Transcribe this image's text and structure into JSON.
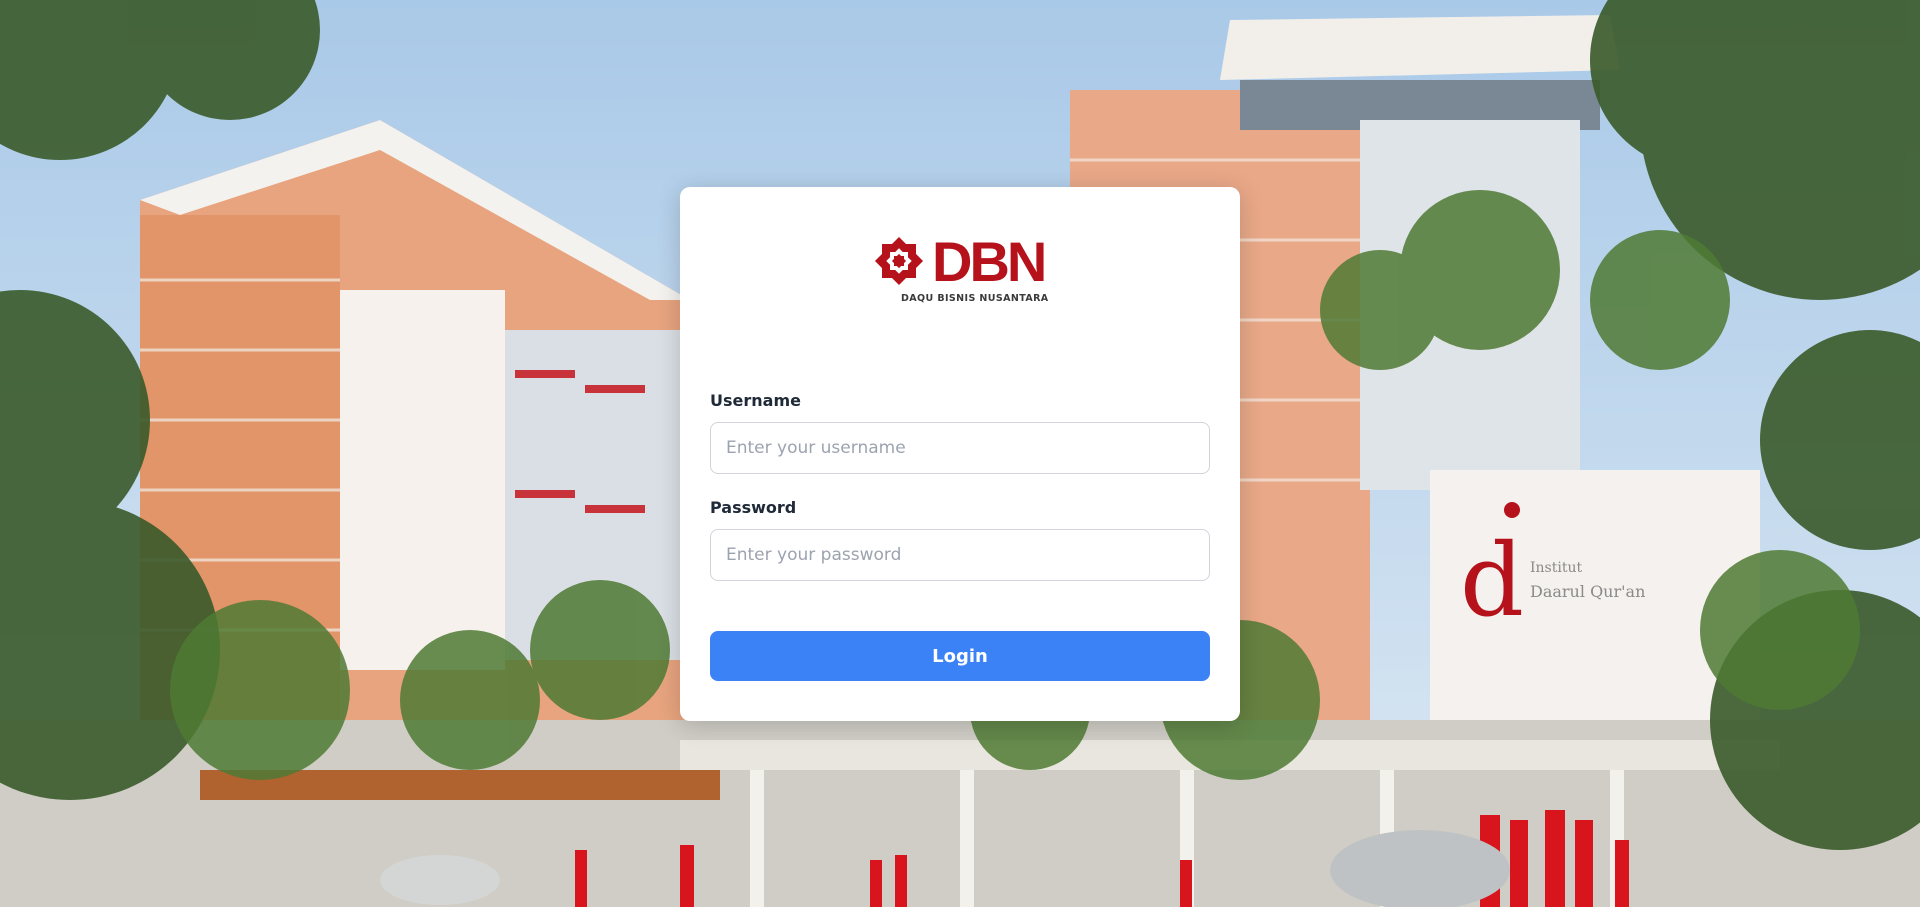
{
  "logo": {
    "name": "DBN",
    "tagline": "DAQU BISNIS NUSANTARA",
    "brand_color": "#b5121b"
  },
  "background": {
    "sign_text_1": "Institut",
    "sign_text_2": "Daarul Qur'an"
  },
  "form": {
    "username_label": "Username",
    "username_placeholder": "Enter your username",
    "username_value": "",
    "password_label": "Password",
    "password_placeholder": "Enter your password",
    "password_value": "",
    "login_label": "Login",
    "button_color": "#3b82f6"
  }
}
